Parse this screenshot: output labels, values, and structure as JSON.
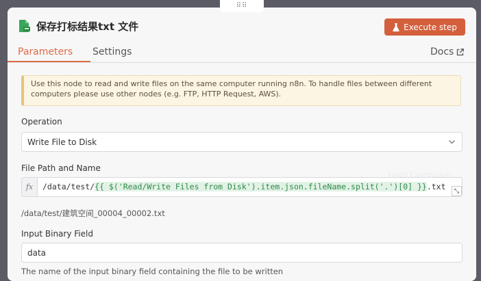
{
  "node": {
    "title": "保存打标结果txt 文件",
    "execute_label": "Execute step"
  },
  "tabs": {
    "parameters": "Parameters",
    "settings": "Settings",
    "docs": "Docs"
  },
  "notice": {
    "text": "Use this node to read and write files on the same computer running n8n. To handle files between different computers please use other nodes (e.g. FTP, HTTP Request, AWS)."
  },
  "operation": {
    "label": "Operation",
    "value": "Write File to Disk"
  },
  "file_path": {
    "label": "File Path and Name",
    "prefix": "/data/test/",
    "expression": "{{ $('Read/Write Files from Disk').item.json.fileName.split('.')[0] }}",
    "suffix": ".txt",
    "preview": "/data/test/建筑空间_00004_00002.txt",
    "ghost_hint": "Fixed Expression"
  },
  "binary_field": {
    "label": "Input Binary Field",
    "value": "data",
    "hint": "The name of the input binary field containing the file to be written"
  },
  "colors": {
    "accent": "#e06a44",
    "button": "#d35f3d",
    "node_icon": "#3aa55a"
  },
  "icons": {
    "drag": "drag-handle-icon",
    "node": "file-icon",
    "flask": "flask-icon",
    "external": "external-link-icon",
    "chevron": "chevron-down-icon",
    "expand": "expand-icon"
  }
}
